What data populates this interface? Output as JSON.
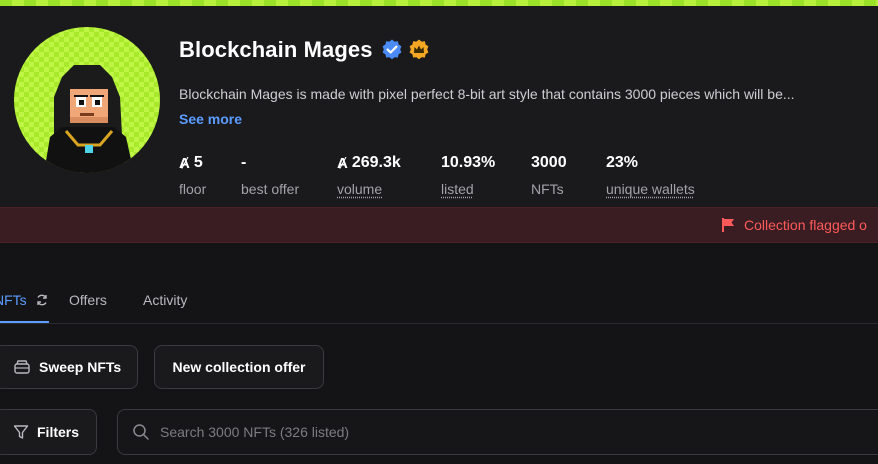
{
  "collection": {
    "name": "Blockchain Mages",
    "description": "Blockchain Mages is made with pixel perfect 8-bit art style that contains 3000 pieces which will be...",
    "see_more": "See more"
  },
  "stats": [
    {
      "value": "5",
      "label": "floor",
      "currency": true,
      "underlined": false
    },
    {
      "value": "-",
      "label": "best offer",
      "currency": false,
      "underlined": false
    },
    {
      "value": "269.3k",
      "label": "volume",
      "currency": true,
      "underlined": true
    },
    {
      "value": "10.93%",
      "label": "listed",
      "currency": false,
      "underlined": true
    },
    {
      "value": "3000",
      "label": "NFTs",
      "currency": false,
      "underlined": false
    },
    {
      "value": "23%",
      "label": "unique wallets",
      "currency": false,
      "underlined": true
    }
  ],
  "currency_symbol": "Ⱥ",
  "flag_message": "Collection flagged o",
  "tabs": [
    {
      "label": "NFTs",
      "active": true
    },
    {
      "label": "Offers",
      "active": false
    },
    {
      "label": "Activity",
      "active": false
    }
  ],
  "buttons": {
    "sweep": "Sweep NFTs",
    "new_offer": "New collection offer",
    "filters": "Filters"
  },
  "search": {
    "placeholder": "Search 3000 NFTs (326 listed)"
  },
  "icons": {
    "verified": "verified-badge-icon",
    "featured": "featured-badge-icon",
    "flag": "flag-icon",
    "refresh": "refresh-icon",
    "sweep": "sweep-icon",
    "filter": "filter-icon",
    "search": "search-icon"
  },
  "colors": {
    "accent": "#5b9cff",
    "verified": "#4b8bf5",
    "featured": "#f5a623",
    "warning": "#ff5a5a",
    "top_bar": "#9be12a"
  }
}
